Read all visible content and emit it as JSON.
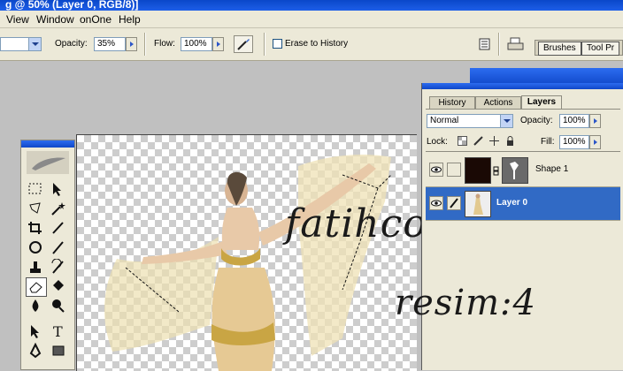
{
  "window": {
    "title": "g @ 50% (Layer 0, RGB/8)]"
  },
  "menu": [
    {
      "label": "View"
    },
    {
      "label": "Window"
    },
    {
      "label": "onOne"
    },
    {
      "label": "Help"
    }
  ],
  "options": {
    "opacity_label": "Opacity:",
    "opacity_value": "35%",
    "flow_label": "Flow:",
    "flow_value": "100%",
    "erase_history_label": "Erase to History",
    "well_tabs": [
      "Brushes",
      "Tool Pr"
    ]
  },
  "canvas_text": {
    "signature": "fatihcolor",
    "caption": "resim:4"
  },
  "palette": {
    "tabs": [
      "History",
      "Actions",
      "Layers"
    ],
    "active_tab": "Layers",
    "blend_mode": "Normal",
    "opacity_label": "Opacity:",
    "opacity_value": "100%",
    "lock_label": "Lock:",
    "fill_label": "Fill:",
    "fill_value": "100%",
    "layers": [
      {
        "name": "Shape 1",
        "selected": false
      },
      {
        "name": "Layer 0",
        "selected": true
      }
    ]
  },
  "colors": {
    "title_bar": "#0f4fd8",
    "chrome": "#ece9d8",
    "selection": "#316ac5",
    "script_text": "#1a1a1a"
  }
}
